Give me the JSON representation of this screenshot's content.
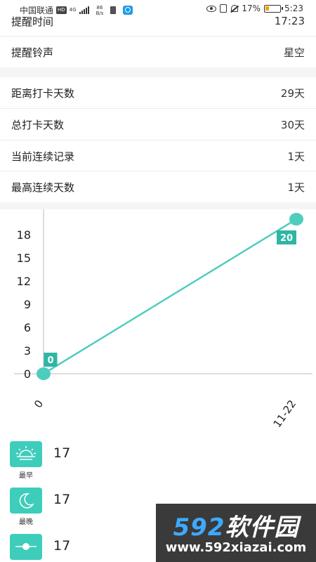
{
  "status_bar": {
    "carrier": "中国联通",
    "hd_badge": "HD",
    "network_type": "4G",
    "speed_value": "86",
    "speed_unit": "B/s",
    "battery_percent": "17%",
    "time": "5:23"
  },
  "settings": {
    "reminder_time": {
      "label": "提醒时间",
      "value": "17:23"
    },
    "reminder_ringtone": {
      "label": "提醒铃声",
      "value": "星空"
    }
  },
  "stats_list": [
    {
      "label": "距离打卡天数",
      "value": "29天"
    },
    {
      "label": "总打卡天数",
      "value": "30天"
    },
    {
      "label": "当前连续记录",
      "value": "1天"
    },
    {
      "label": "最高连续天数",
      "value": "1天"
    }
  ],
  "chart_data": {
    "type": "line",
    "categories": [
      "0",
      "11-22"
    ],
    "values": [
      0,
      20
    ],
    "data_labels": [
      "0",
      "20"
    ],
    "yticks": [
      0,
      3,
      6,
      9,
      12,
      15,
      18
    ],
    "ylim": [
      0,
      20
    ],
    "title": "",
    "xlabel": "",
    "ylabel": "",
    "color": "#4ecdbd",
    "label_bg": "#2fb6a4"
  },
  "time_stats": [
    {
      "icon": "sunrise-icon",
      "caption": "最早",
      "value": "17"
    },
    {
      "icon": "moon-icon",
      "caption": "最晚",
      "value": "17"
    },
    {
      "icon": "average-icon",
      "caption": "",
      "value": "17"
    }
  ],
  "watermark": {
    "title_a": "592",
    "title_b": "软件园",
    "url": "www.592xiazai.com"
  },
  "colors": {
    "accent": "#3ecdbb",
    "section_gap": "#f5f5f5"
  }
}
